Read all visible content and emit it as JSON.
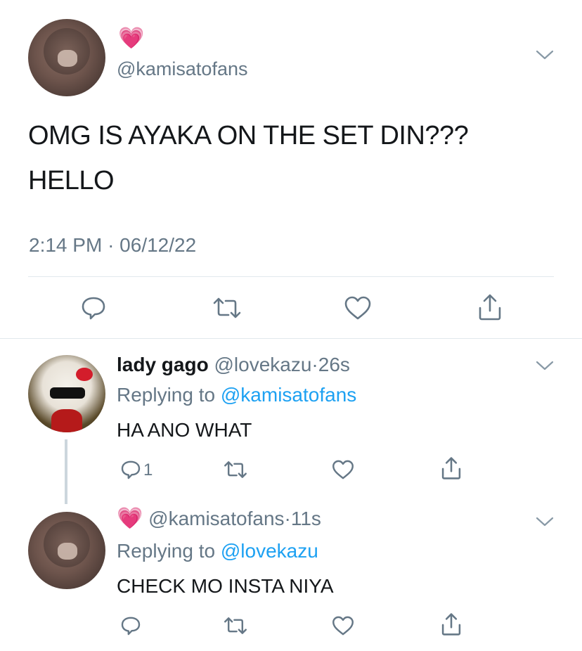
{
  "main_tweet": {
    "emoji": "💗",
    "handle": "@kamisatofans",
    "text_line1": "OMG IS AYAKA ON THE SET DIN???",
    "text_line2": "HELLO",
    "time": "2:14 PM",
    "sep": "·",
    "date": "06/12/22"
  },
  "reply1": {
    "name": "lady gago",
    "handle": "@lovekazu",
    "sep": "·",
    "age": "26s",
    "replying_prefix": "Replying to",
    "replying_to": "@kamisatofans",
    "text": "HA ANO WHAT",
    "reply_count": "1"
  },
  "reply2": {
    "emoji": "💗",
    "handle": "@kamisatofans",
    "sep": "·",
    "age": "11s",
    "replying_prefix": "Replying to",
    "replying_to": "@lovekazu",
    "text": "CHECK MO INSTA NIYA"
  },
  "colors": {
    "text": "#14171a",
    "secondary": "#657786",
    "link": "#1da1f2",
    "divider": "#e1e8ed",
    "heart_emoji": "#f062a6"
  }
}
